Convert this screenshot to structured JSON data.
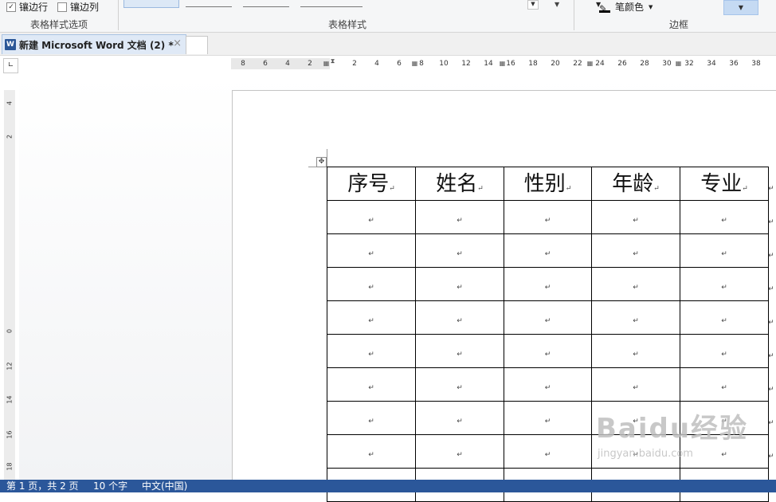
{
  "ribbon": {
    "banded_rows": {
      "label": "镶边行",
      "checked": true
    },
    "banded_columns": {
      "label": "镶边列",
      "checked": false
    },
    "group_style_options": "表格样式选项",
    "group_table_styles": "表格样式",
    "pen_color_label": "笔颜色",
    "group_borders": "边框"
  },
  "tab": {
    "app_icon": "W",
    "title": "新建 Microsoft Word 文档 (2) *",
    "close": "×"
  },
  "ruler": {
    "horizontal_labels": [
      "8",
      "6",
      "4",
      "2",
      "2",
      "4",
      "6",
      "8",
      "10",
      "12",
      "14",
      "16",
      "18",
      "20",
      "22",
      "24",
      "26",
      "28",
      "30",
      "32",
      "34",
      "36",
      "38"
    ],
    "vertical_labels": [
      "4",
      "2",
      "0",
      "12",
      "14",
      "16",
      "18"
    ]
  },
  "table": {
    "headers": [
      "序号",
      "姓名",
      "性别",
      "年龄",
      "专业"
    ],
    "empty_rows": 9,
    "cell_mark": "↵"
  },
  "watermark": {
    "brand": "Baidu经验",
    "url": "jingyan.baidu.com"
  },
  "status": {
    "page": "第 1 页，共 2 页",
    "words": "10 个字",
    "language": "中文(中国)"
  },
  "colors": {
    "status_bar": "#2b579a",
    "tab_active": "#dfe9f6"
  }
}
